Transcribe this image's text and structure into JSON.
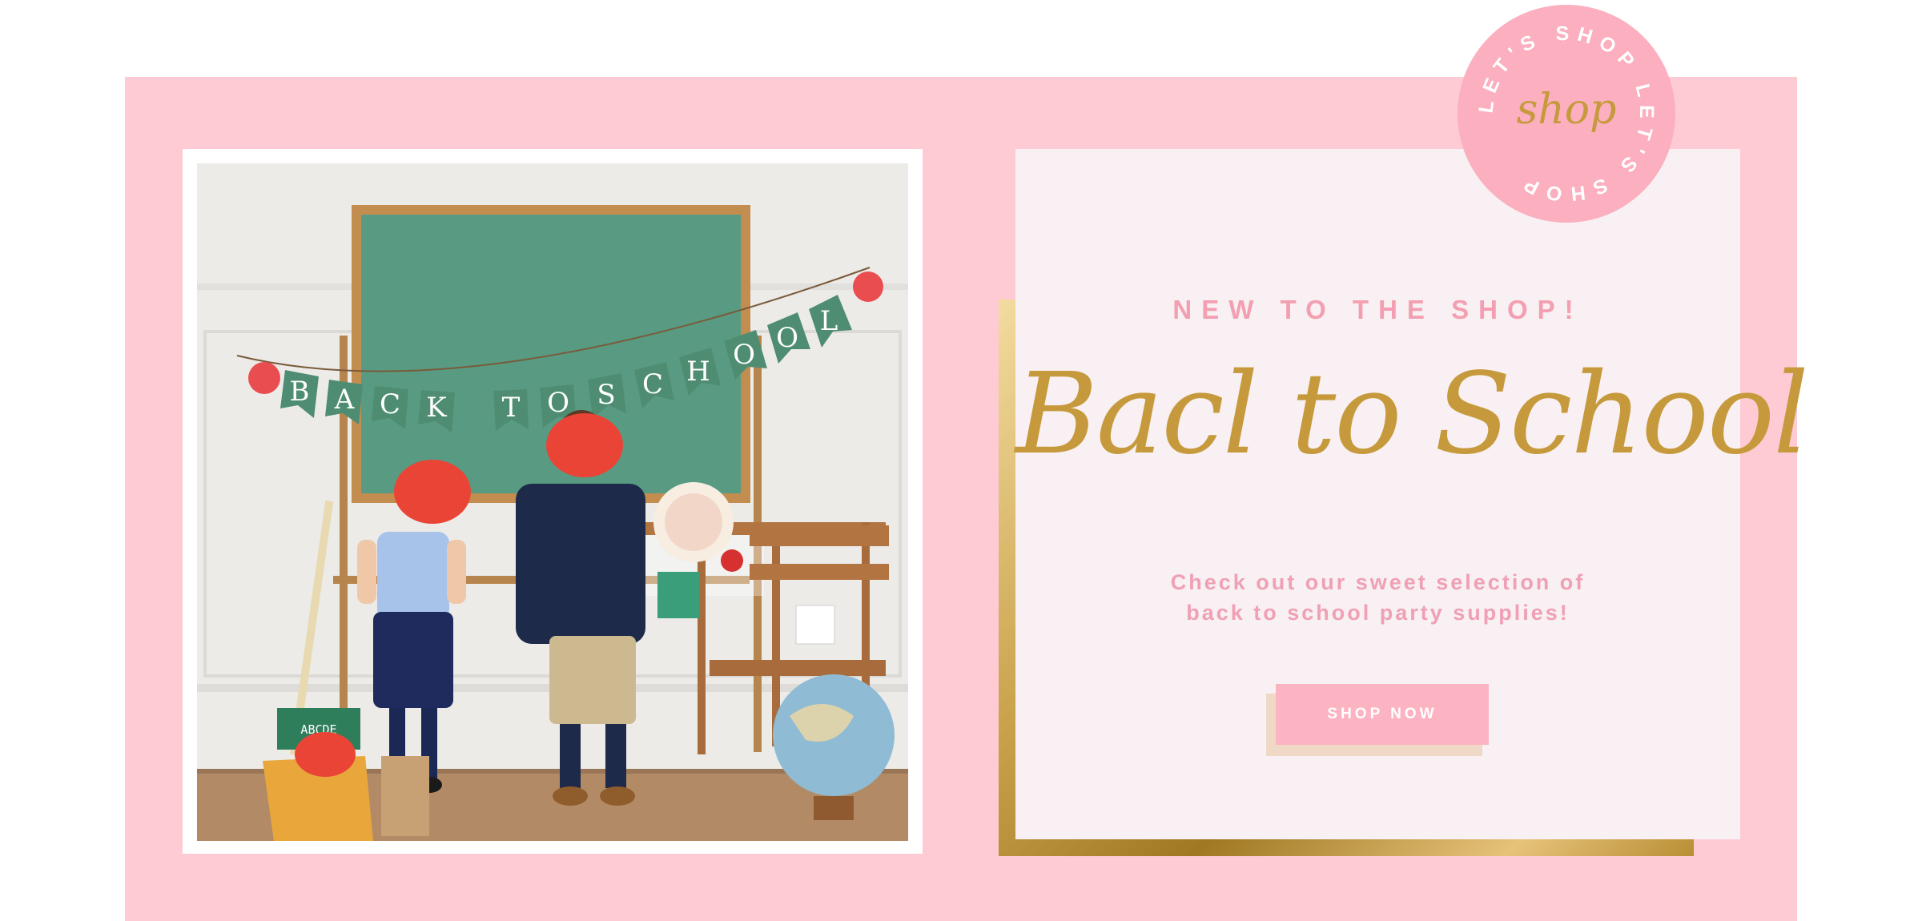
{
  "hero": {
    "eyebrow": "NEW TO THE SHOP!",
    "headline": "Bacl to School",
    "description_lines": [
      "Check out our sweet selection of",
      "back to school party supplies!"
    ],
    "cta_label": "SHOP NOW"
  },
  "badge": {
    "ring_text": "LET'S SHOP LET'S SHOP",
    "center_text": "shop"
  },
  "photo": {
    "banner_letters": [
      "B",
      "A",
      "C",
      "K",
      "T",
      "O",
      "S",
      "C",
      "H",
      "O",
      "O",
      "L"
    ],
    "chalkboard_letters": "ABCDE"
  },
  "colors": {
    "panel_pink": "#fecbd5",
    "card_bg": "#f8f0f2",
    "accent_gold": "#c69a3c",
    "text_pink": "#f39fb1",
    "button_pink": "#fdb4c2",
    "badge_pink": "#fbafbf"
  }
}
